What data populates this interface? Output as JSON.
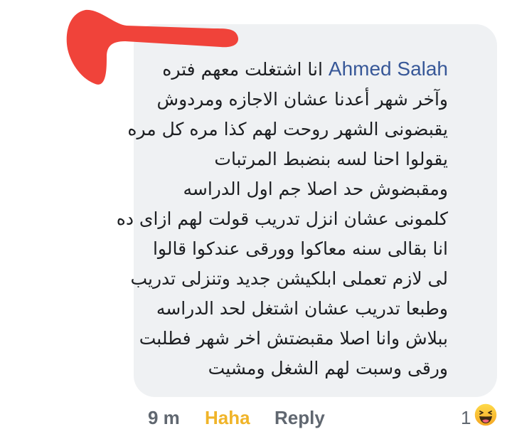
{
  "comment": {
    "author": "Ahmed Salah",
    "first_line_text": "انا اشتغلت معهم فتره",
    "lines": [
      "وآخر شهر أعدنا عشان الاجازه ومردوش",
      "يقبضونى الشهر روحت لهم كذا مره كل مره",
      "يقولوا    احنا لسه بنضبط المرتبات",
      "ومقبضوش حد اصلا جم اول الدراسه",
      "كلمونى عشان انزل تدريب قولت لهم ازاى ده",
      "انا بقالى سنه معاكوا وورقى عندكوا قالوا",
      "لى لازم تعملى ابلكيشن جديد وتنزلى تدريب",
      "وطبعا تدريب عشان اشتغل لحد الدراسه",
      "ببلاش وانا اصلا مقبضتش اخر شهر فطلبت",
      "ورقى وسبت لهم الشغل ومشيت"
    ]
  },
  "actions": {
    "time": "9 m",
    "haha_label": "Haha",
    "reply_label": "Reply",
    "reaction_count": "1",
    "reaction_icon": "haha-emoji-icon"
  },
  "colors": {
    "bubble": "#eff1f3",
    "author": "#385898",
    "haha": "#f0b429",
    "redaction": "#f0433a"
  }
}
